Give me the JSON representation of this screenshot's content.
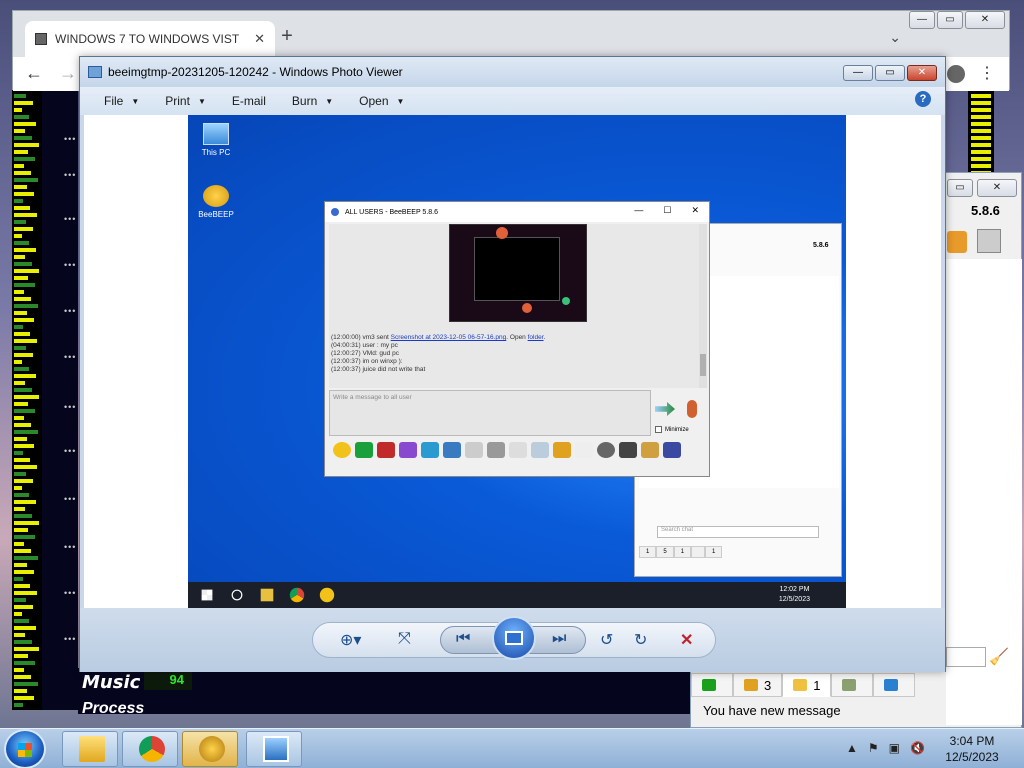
{
  "chrome": {
    "tab_title": "WINDOWS 7 TO WINDOWS VIST",
    "tab_close": "✕",
    "new_tab": "+",
    "back": "←",
    "forward": "→",
    "menu": "⋮",
    "chevron": "⌄",
    "caps": [
      "—",
      "▭",
      "✕"
    ]
  },
  "desktop": {
    "music_label": "Music",
    "music_level": "94",
    "music_label2": "Process"
  },
  "beebeep_big": {
    "version": "5.8.6",
    "caps": [
      "▭",
      "✕"
    ],
    "tabs": [
      {
        "count": "",
        "color": "#1aa01a"
      },
      {
        "count": "3",
        "color": "#e0a020"
      },
      {
        "count": "1",
        "color": "#f0c040"
      },
      {
        "count": "",
        "color": "#8aa070"
      },
      {
        "count": "",
        "color": "#2a80d0"
      }
    ],
    "status": "You have new message"
  },
  "photo_viewer": {
    "title": "beeimgtmp-20231205-120242 - Windows Photo Viewer",
    "caps": [
      "—",
      "▭",
      "✕"
    ],
    "menu": [
      {
        "label": "File",
        "arrow": "▼"
      },
      {
        "label": "Print",
        "arrow": "▼"
      },
      {
        "label": "E-mail",
        "arrow": ""
      },
      {
        "label": "Burn",
        "arrow": "▼"
      },
      {
        "label": "Open",
        "arrow": "▼"
      }
    ],
    "help": "?",
    "controls": {
      "zoom": "⊕▾",
      "fit": "⤧",
      "prev": "⏮",
      "next": "⏭",
      "rotate_ccw": "↺",
      "rotate_cw": "↻",
      "delete": "✕"
    }
  },
  "screenshot": {
    "icons": [
      {
        "label": "This PC"
      },
      {
        "label": "BeeBEEP"
      }
    ],
    "chat": {
      "title": "ALL USERS - BeeBEEP 5.8.6",
      "caps": [
        "—",
        "☐",
        "✕"
      ],
      "lines": [
        {
          "time": "(12:00:00)",
          "text": "vm3 sent ",
          "link": "Screenshot at 2023-12-05 06-57-16.png",
          "after": ". Open ",
          "link2": "folder",
          "end": "."
        },
        {
          "time": "(04:00:31)",
          "text": "user : my pc"
        },
        {
          "time": "(12:00:27)",
          "text": "VMd: gud pc"
        },
        {
          "time": "(12:00:37)",
          "text": "im on winxp ):"
        },
        {
          "time": "(12:00:37)",
          "text": "juice did not write that"
        }
      ],
      "input_placeholder": "Write a message to all user",
      "minimize_label": "Minimize"
    },
    "bb": {
      "version": "5.8.6",
      "search_placeholder": "Search chat",
      "tabs": [
        "1",
        "5",
        "1",
        "",
        "1"
      ]
    },
    "clock_time": "12:02 PM",
    "clock_date": "12/5/2023"
  },
  "taskbar": {
    "clock_time": "3:04 PM",
    "clock_date": "12/5/2023",
    "tray": [
      "▲",
      "⚑",
      "▣",
      "🔇"
    ]
  }
}
